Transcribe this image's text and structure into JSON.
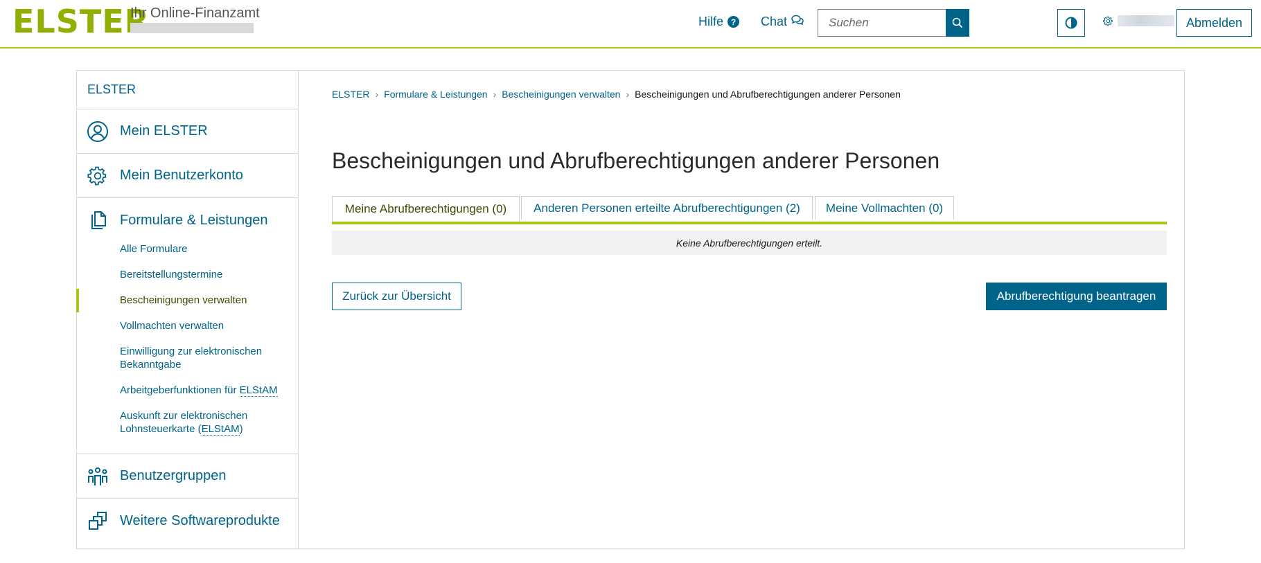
{
  "header": {
    "logo": "ELSTER",
    "subtitle": "Ihr Online-Finanzamt",
    "help_label": "Hilfe",
    "chat_label": "Chat",
    "search_placeholder": "Suchen",
    "logout_label": "Abmelden"
  },
  "sidebar": {
    "top_label": "ELSTER",
    "sections": [
      {
        "label": "Mein ELSTER",
        "icon": "user-circle-icon"
      },
      {
        "label": "Mein Benutzerkonto",
        "icon": "gear-icon"
      },
      {
        "label": "Formulare & Leistungen",
        "icon": "documents-icon"
      },
      {
        "label": "Benutzergruppen",
        "icon": "user-group-icon"
      },
      {
        "label": "Weitere Softwareprodukte",
        "icon": "stacked-windows-icon"
      }
    ],
    "sub_items": [
      {
        "label": "Alle Formulare"
      },
      {
        "label": "Bereitstellungstermine"
      },
      {
        "label": "Bescheinigungen verwalten",
        "active": true
      },
      {
        "label": "Vollmachten verwalten"
      },
      {
        "label": "Einwilligung zur elektronischen Bekanntgabe"
      },
      {
        "label_pre": "Arbeitgeberfunktionen für ",
        "abbr": "ELStAM"
      },
      {
        "label_pre": "Auskunft zur elektronischen Lohnsteuerkarte (",
        "abbr": "ELStAM",
        "label_post": ")"
      }
    ]
  },
  "breadcrumb": {
    "items": [
      "ELSTER",
      "Formulare & Leistungen",
      "Bescheinigungen verwalten"
    ],
    "current": "Bescheinigungen und Abrufberechtigungen anderer Personen"
  },
  "main": {
    "title": "Bescheinigungen und Abrufberechtigungen anderer Personen",
    "tabs": [
      {
        "label": "Meine Abrufberechtigungen (0)",
        "active": true
      },
      {
        "label": "Anderen Personen erteilte Abrufberechtigungen (2)",
        "active": false
      },
      {
        "label": "Meine Vollmachten (0)",
        "active": false
      }
    ],
    "empty_message": "Keine Abrufberechtigungen erteilt.",
    "back_button": "Zurück zur Übersicht",
    "primary_button": "Abrufberechtigung beantragen"
  },
  "colors": {
    "brand_green": "#8fb000",
    "accent_blue": "#00638a",
    "divider_green": "#a3c617"
  }
}
